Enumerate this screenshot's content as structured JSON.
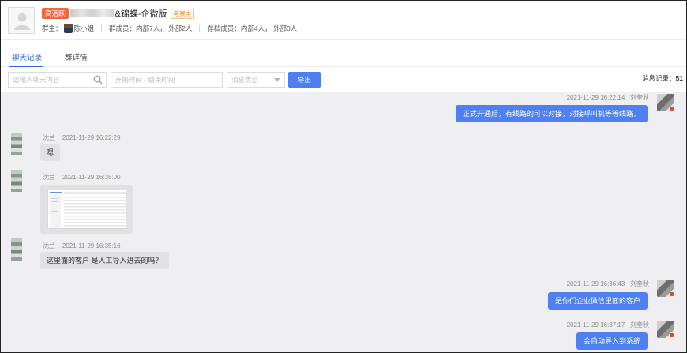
{
  "header": {
    "active_tag": "高活跃",
    "group_title": "&锦蝶-企微版",
    "status_tag": "考察中",
    "owner_label": "群主：",
    "owner_name": "陈小姐",
    "members": "群成员：内部7人， 外部2人",
    "archived": "存档成员：内部4人， 外部0人"
  },
  "tabs": [
    {
      "label": "聊天记录",
      "active": true
    },
    {
      "label": "群详情",
      "active": false
    }
  ],
  "filters": {
    "search_placeholder": "请输入聊天内容",
    "time_placeholder": "开始时间 - 结束时间",
    "type_placeholder": "消息类型",
    "export_label": "导出",
    "count_label": "消息记录：",
    "count_value": "51"
  },
  "messages": [
    {
      "direction": "out",
      "sender": "刘奎秋",
      "time": "2021-11-29 16:22:14",
      "text": "正式开通后，有线路的可以对接，对接呼叫机等等线路，"
    },
    {
      "direction": "in",
      "sender": "沈兰",
      "time": "2021-11-29 16:22:29",
      "text": "嗯"
    },
    {
      "direction": "in",
      "sender": "沈兰",
      "time": "2021-11-29 16:35:00",
      "text": ""
    },
    {
      "direction": "in",
      "sender": "沈兰",
      "time": "2021-11-29 16:35:16",
      "text": "这里面的客户 是人工导入进去的吗？"
    },
    {
      "direction": "out",
      "sender": "刘奎秋",
      "time": "2021-11-29 16:36:43",
      "text": "是你们企业微信里面的客户"
    },
    {
      "direction": "out",
      "sender": "刘奎秋",
      "time": "2021-11-29 16:37:17",
      "text": "会自动导入到系统"
    }
  ]
}
